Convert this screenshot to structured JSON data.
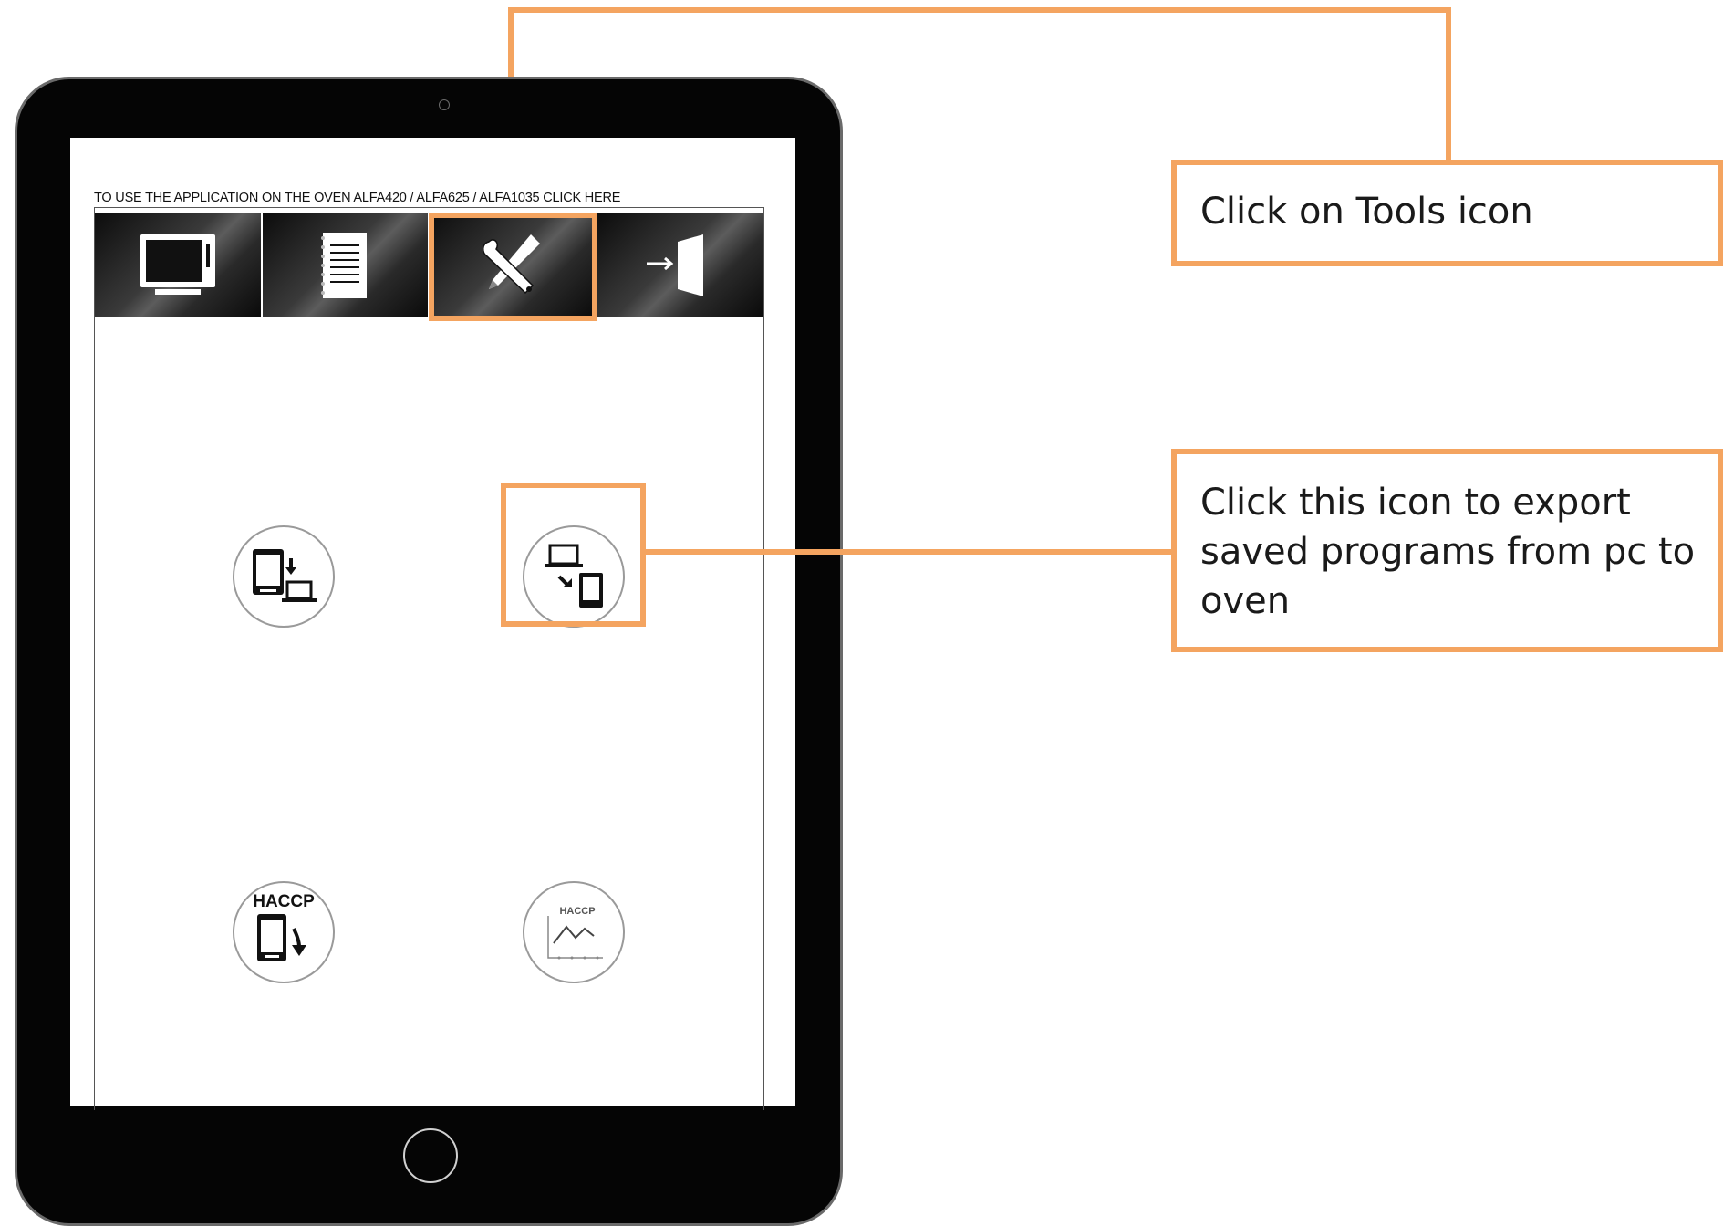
{
  "screen": {
    "instruction": "TO USE THE APPLICATION ON THE OVEN ALFA420 / ALFA625 / ALFA1035 CLICK HERE"
  },
  "tabs": [
    {
      "icon": "oven-icon"
    },
    {
      "icon": "notebook-icon"
    },
    {
      "icon": "tools-icon"
    },
    {
      "icon": "logout-door-icon"
    }
  ],
  "tools": [
    {
      "icon": "oven-to-pc-export-icon"
    },
    {
      "icon": "pc-to-oven-export-icon"
    },
    {
      "icon": "haccp-download-icon",
      "label": "HACCP"
    },
    {
      "icon": "haccp-chart-icon",
      "label": "HACCP"
    }
  ],
  "callouts": {
    "tools": "Click on Tools icon",
    "export": "Click this icon to export saved programs from pc to oven"
  },
  "colors": {
    "accent": "#F4A460",
    "bezel": "#050505"
  }
}
